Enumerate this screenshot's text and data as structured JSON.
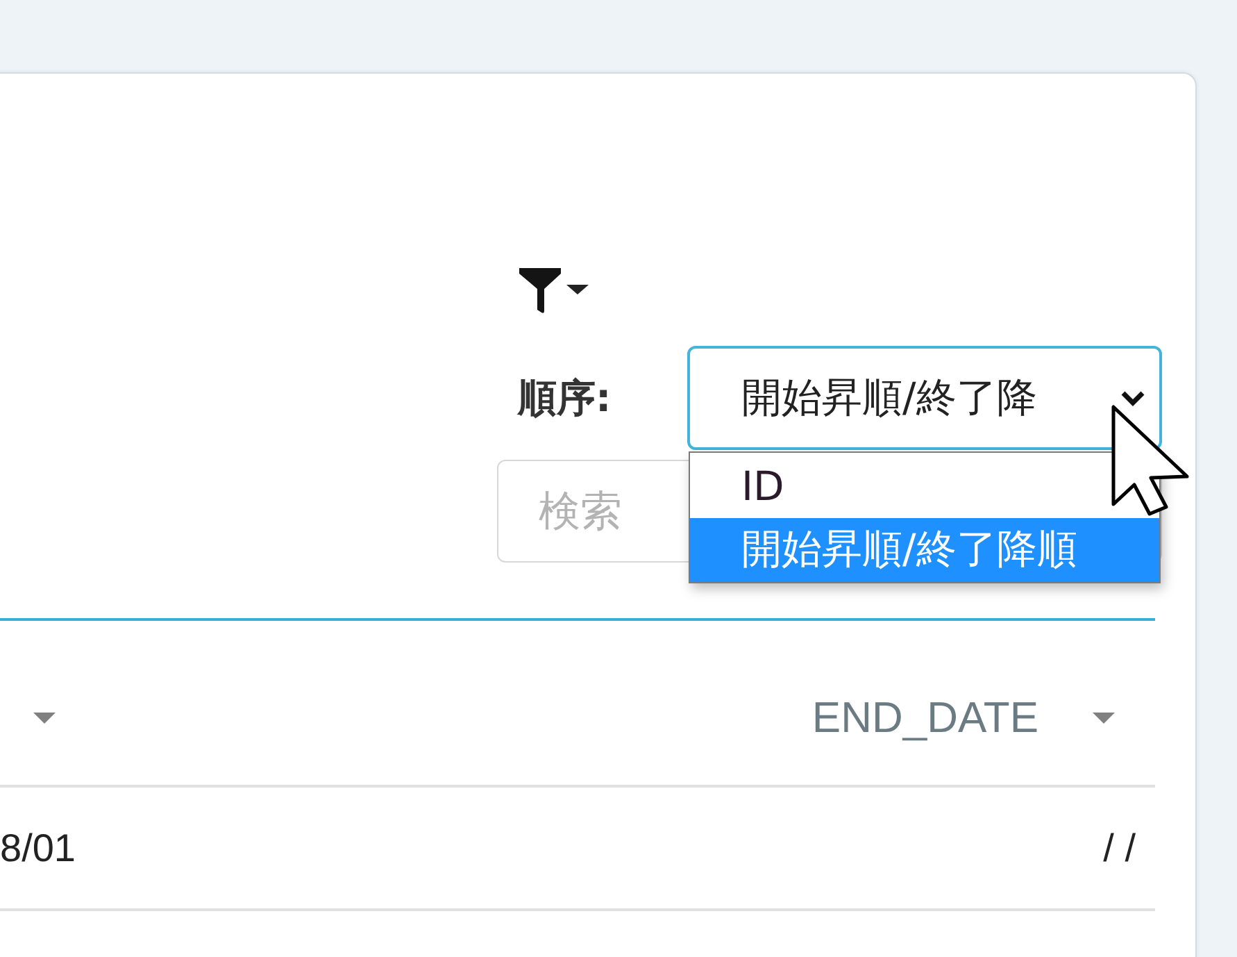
{
  "sort": {
    "label": "順序:",
    "value": "開始昇順/終了降",
    "focused": true,
    "expanded": true,
    "options": [
      {
        "label": "ID",
        "selected": false
      },
      {
        "label": "開始昇順/終了降順",
        "selected": true
      }
    ]
  },
  "search": {
    "placeholder": "検索"
  },
  "table": {
    "columns": [
      {
        "sortable": true
      },
      {
        "label": "END_DATE",
        "sortable": true
      }
    ],
    "rows": [
      {
        "cells": [
          "8/01",
          "/ /"
        ]
      }
    ]
  }
}
